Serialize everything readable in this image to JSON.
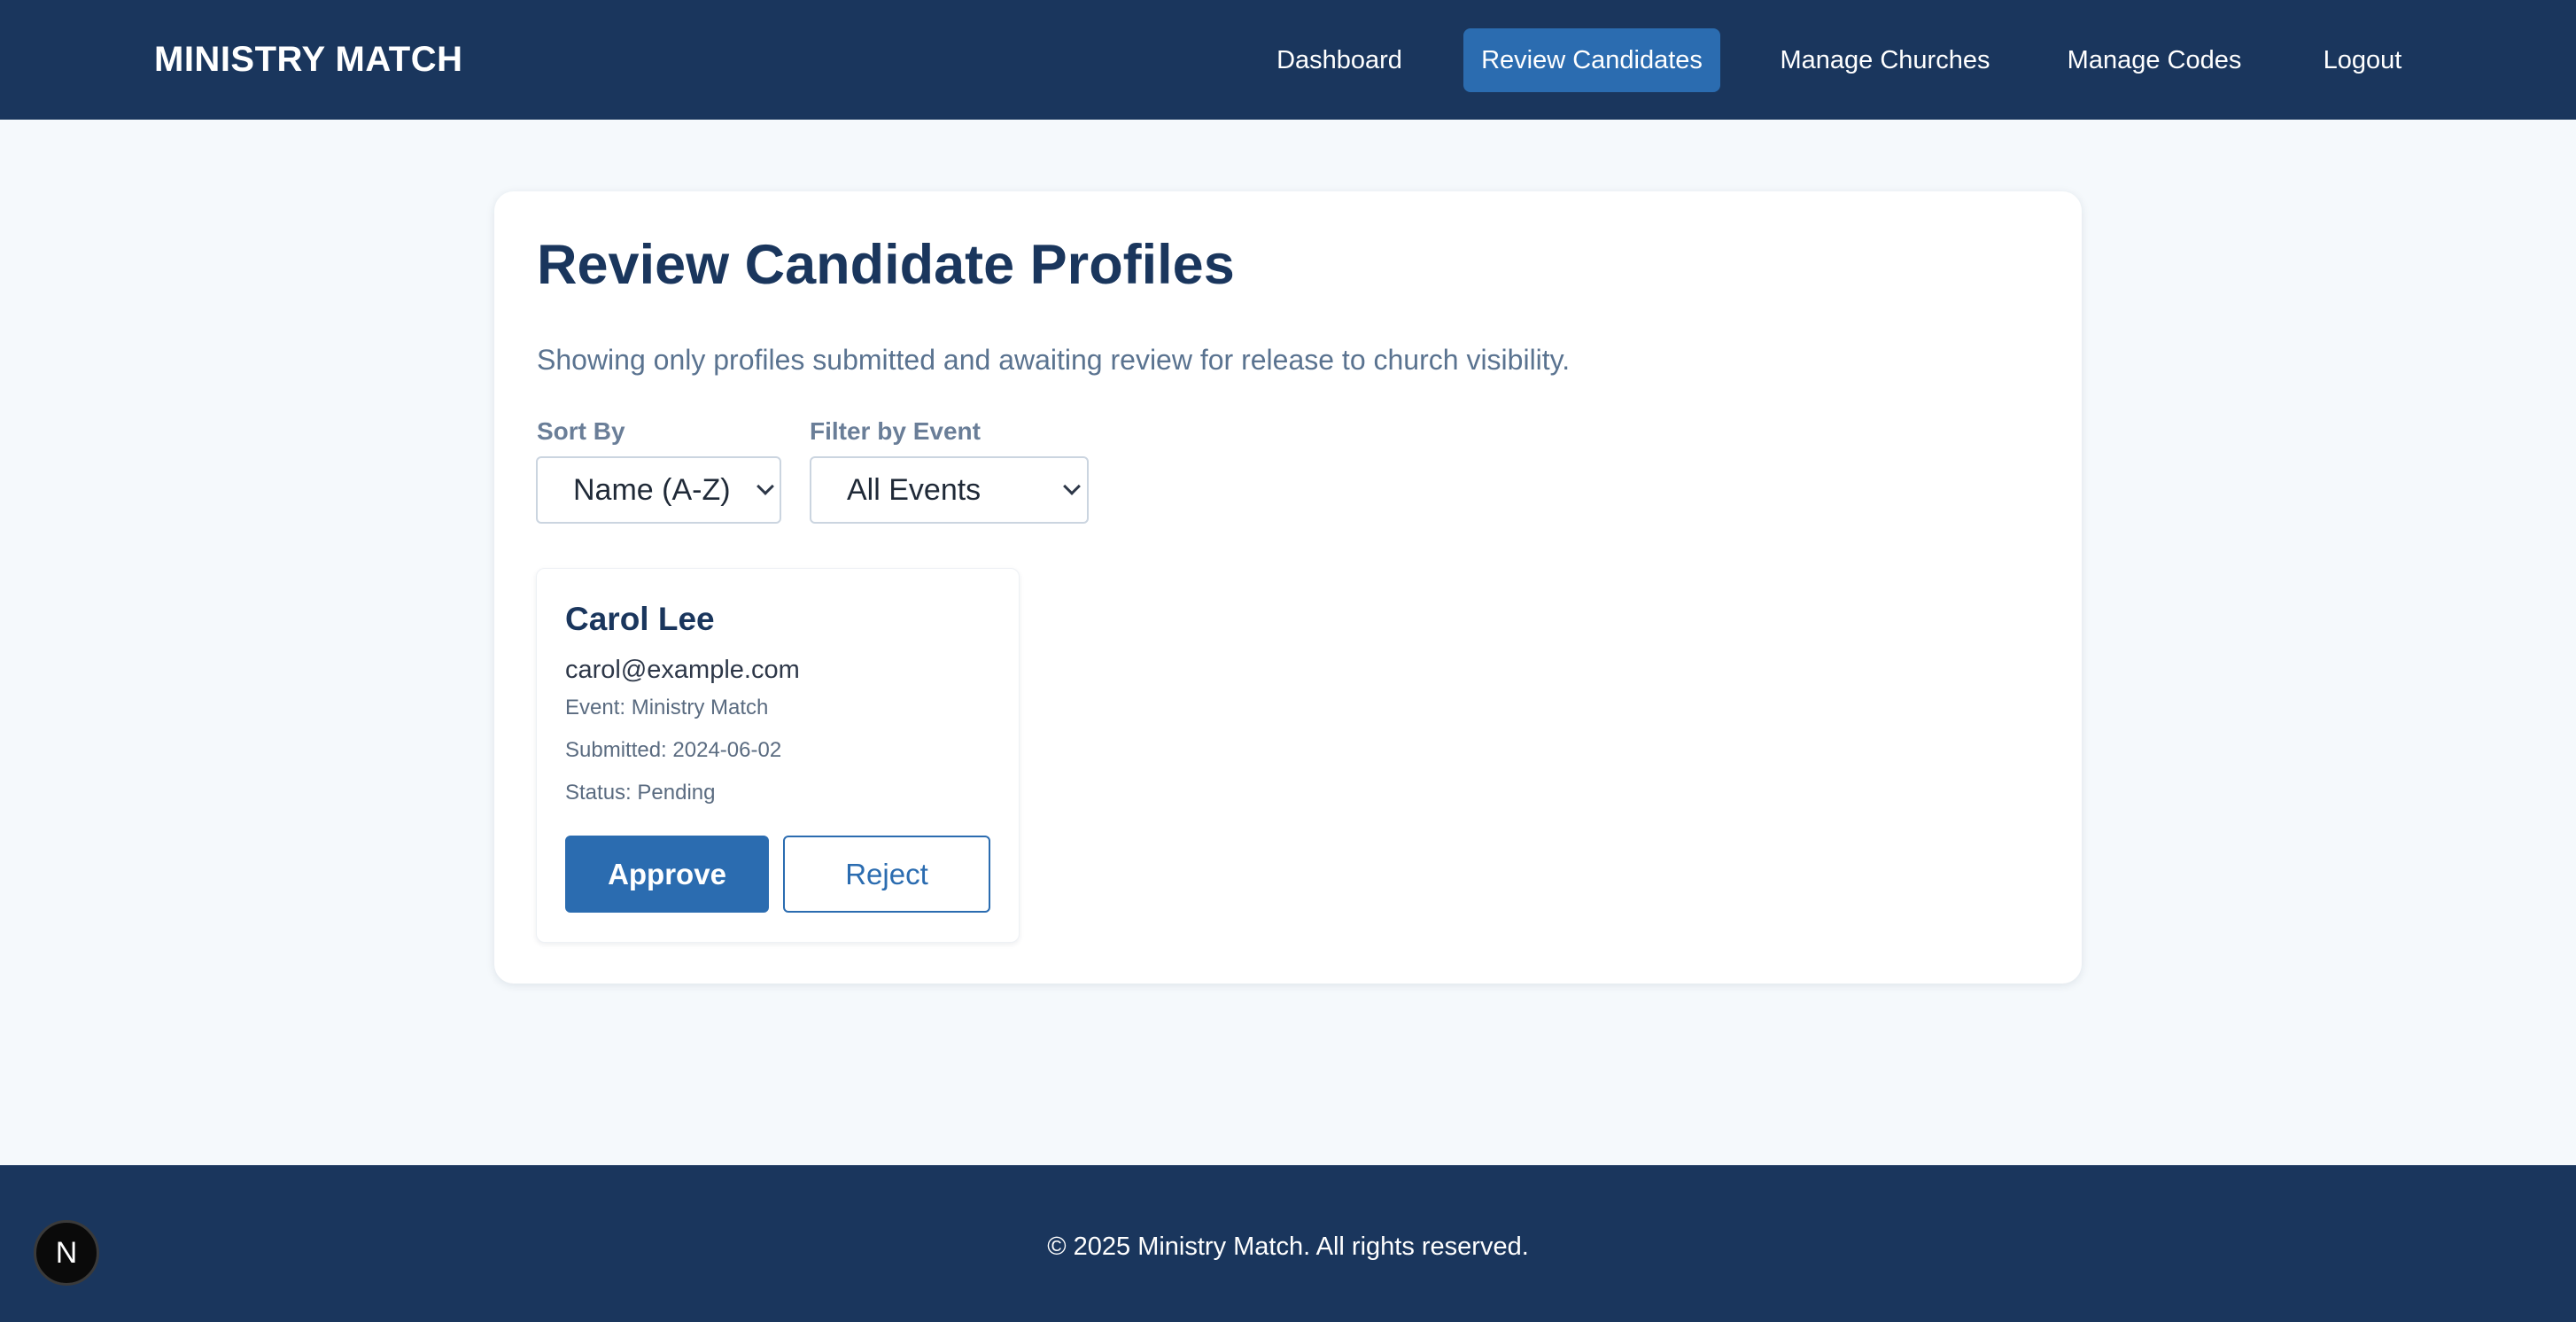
{
  "app": {
    "brand": "MINISTRY MATCH"
  },
  "nav": {
    "items": [
      {
        "label": "Dashboard",
        "active": false
      },
      {
        "label": "Review Candidates",
        "active": true
      },
      {
        "label": "Manage Churches",
        "active": false
      },
      {
        "label": "Manage Codes",
        "active": false
      },
      {
        "label": "Logout",
        "active": false
      }
    ]
  },
  "main": {
    "title": "Review Candidate Profiles",
    "subtitle": "Showing only profiles submitted and awaiting review for release to church visibility.",
    "filters": {
      "sort_label": "Sort By",
      "sort_value": "Name (A-Z)",
      "event_label": "Filter by Event",
      "event_value": "All Events"
    },
    "candidates": [
      {
        "name": "Carol Lee",
        "email": "carol@example.com",
        "event_label": "Event:",
        "event": "Ministry Match",
        "submitted_label": "Submitted:",
        "submitted": "2024-06-02",
        "status_label": "Status:",
        "status": "Pending",
        "approve_label": "Approve",
        "reject_label": "Reject"
      }
    ]
  },
  "footer": {
    "text": "© 2025 Ministry Match. All rights reserved."
  },
  "dev_badge": {
    "letter": "N"
  },
  "colors": {
    "header_bg": "#1a365d",
    "accent": "#2b6cb0",
    "page_bg": "#f5f9fc",
    "title": "#1a365d"
  }
}
